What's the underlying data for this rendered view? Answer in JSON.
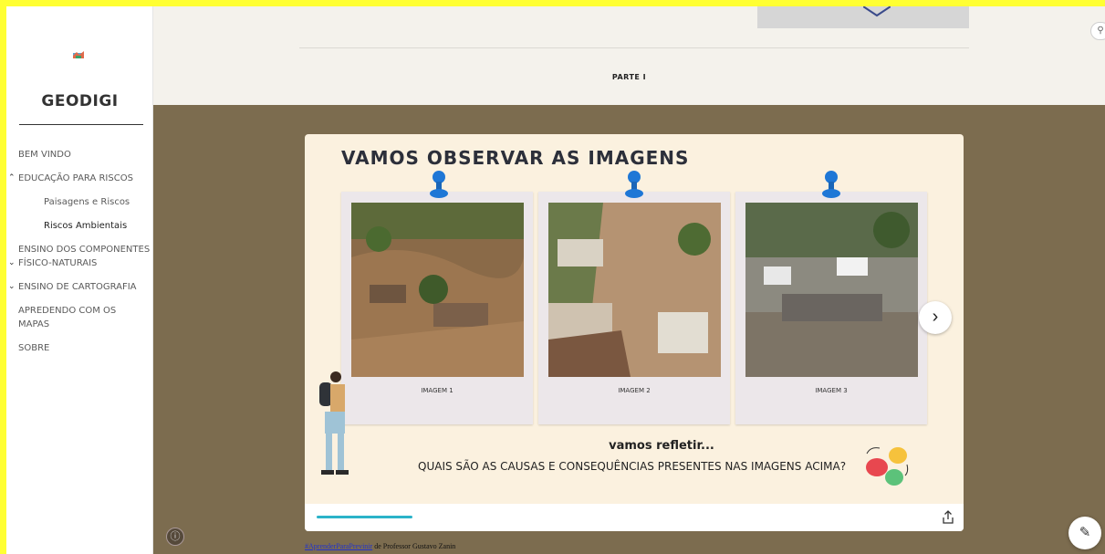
{
  "site": {
    "title": "GEODIGI",
    "logo_icon": "map-logo-icon"
  },
  "nav": {
    "items": [
      {
        "label": "BEM VINDO"
      },
      {
        "label": "EDUCAÇÃO PARA RISCOS",
        "state": "expanded"
      },
      {
        "label": "Paisagens e Riscos"
      },
      {
        "label": "Riscos Ambientais",
        "active": true
      },
      {
        "label": "ENSINO DOS COMPONENTES FÍSICO-NATURAIS",
        "state": "collapsed"
      },
      {
        "label": "ENSINO DE CARTOGRAFIA",
        "state": "collapsed"
      },
      {
        "label": "APREDENDO COM OS MAPAS"
      },
      {
        "label": "SOBRE"
      }
    ]
  },
  "header": {
    "section_label": "PARTE I"
  },
  "card": {
    "title": "VAMOS OBSERVAR AS IMAGENS",
    "images": [
      {
        "caption": "IMAGEM 1"
      },
      {
        "caption": "IMAGEM 2"
      },
      {
        "caption": "IMAGEM 3"
      }
    ],
    "reflect": "vamos refletir...",
    "question": "QUAIS SÃO AS CAUSAS E CONSEQUÊNCIAS PRESENTES NAS IMAGENS ACIMA?",
    "progress": 0.15
  },
  "credit": {
    "hashtag": "#AprenderParaPrevinir",
    "text": " de Professor Gustavo Zanin"
  },
  "colors": {
    "main_bg": "#7c6c4f",
    "card_bg": "#fbf1df",
    "accent": "#2bb3c9",
    "frame": "#ffff33"
  }
}
